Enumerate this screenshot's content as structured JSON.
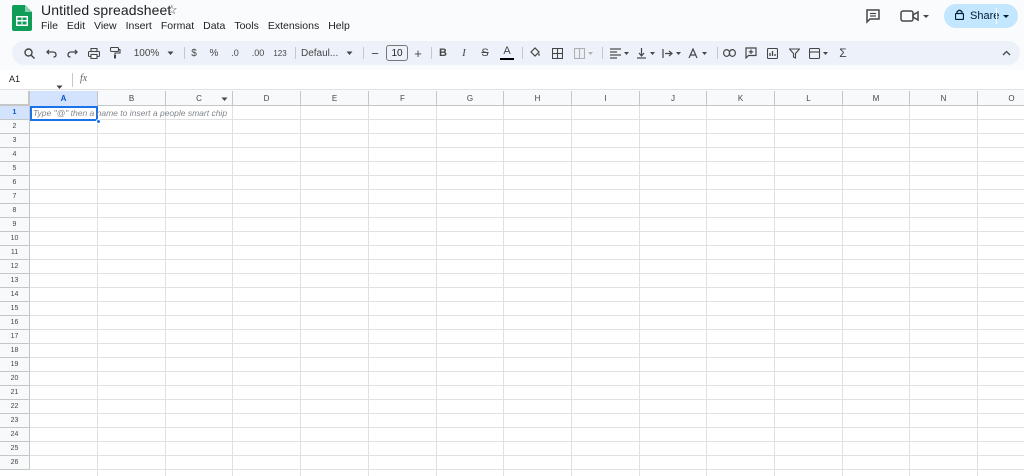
{
  "app": {
    "title": "Untitled spreadsheet",
    "brand_color": "#0f9d58",
    "accent_color": "#1a73e8"
  },
  "menu": [
    "File",
    "Edit",
    "View",
    "Insert",
    "Format",
    "Data",
    "Tools",
    "Extensions",
    "Help"
  ],
  "header_actions": {
    "share_label": "Share"
  },
  "toolbar": {
    "zoom": "100%",
    "currency": "$",
    "percent": "%",
    "decrease_decimal": ".0",
    "increase_decimal": ".00",
    "number_format": "123",
    "font": "Defaul...",
    "font_size": "10",
    "minus": "−",
    "plus": "+",
    "bold": "B",
    "italic": "I",
    "strike": "S",
    "text_color": "A",
    "sum": "Σ"
  },
  "formula_bar": {
    "cell_ref": "A1",
    "fx": "fx"
  },
  "sheet": {
    "columns": [
      "A",
      "B",
      "C",
      "D",
      "E",
      "F",
      "G",
      "H",
      "I",
      "J",
      "K",
      "L",
      "M",
      "N",
      "O"
    ],
    "rows": [
      "1",
      "2",
      "3",
      "4",
      "5",
      "6",
      "7",
      "8",
      "9",
      "10",
      "11",
      "12",
      "13",
      "14",
      "15",
      "16",
      "17",
      "18",
      "19",
      "20",
      "21",
      "22",
      "23",
      "24",
      "25",
      "26"
    ],
    "selected_cell": "A1",
    "cell_hint": "Type \"@\" then a name to insert a people smart chip"
  }
}
